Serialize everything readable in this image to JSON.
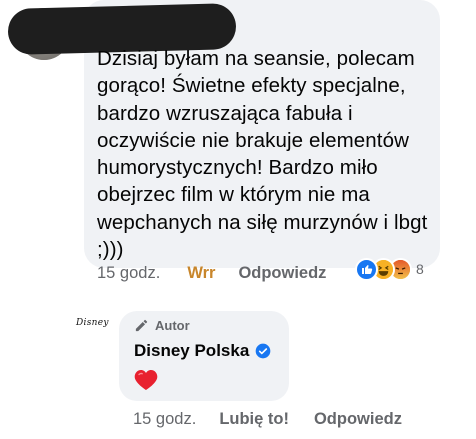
{
  "comment1": {
    "text": "Dzisiaj byłam na seansie, polecam gorąco! Świetne efekty specjalne, bardzo wzruszająca fabuła i oczywiście nie brakuje elementów humorystycznych! Bardzo miło obejrzec film w którym nie ma wepchanych na siłę murzynów i lbgt ;)))",
    "time": "15 godz.",
    "user_reaction": "Wrr",
    "reply_label": "Odpowiedz",
    "reactions": {
      "icons": [
        "like-icon",
        "haha-icon",
        "angry-icon"
      ],
      "count": "8"
    }
  },
  "comment2": {
    "logo_text": "Disney",
    "author_badge": "Autor",
    "author_name": "Disney Polska",
    "verified_icon": "verified-badge-icon",
    "content_icon": "red-heart-emoji",
    "time": "15 godz.",
    "like_label": "Lubię to!",
    "reply_label": "Odpowiedz"
  },
  "colors": {
    "bubble": "#f0f2f5",
    "secondary_text": "#65676b",
    "angry_reaction": "#c8862b",
    "facebook_blue": "#1877f2"
  }
}
